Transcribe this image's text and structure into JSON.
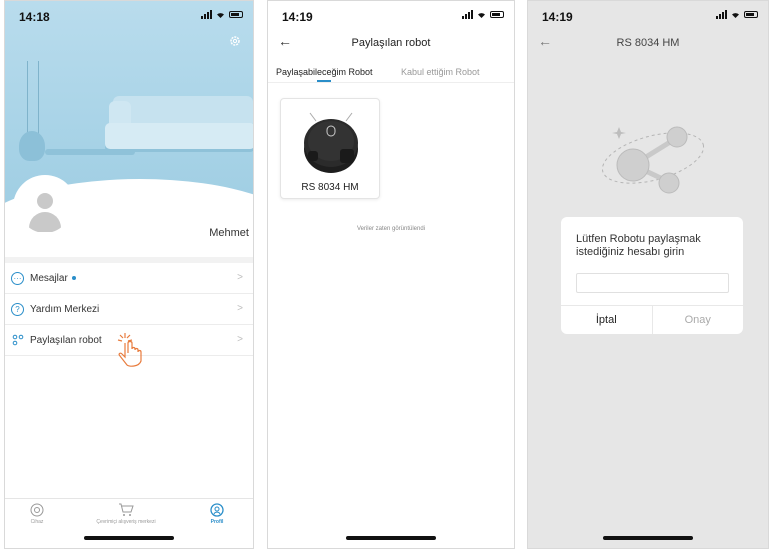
{
  "screen1": {
    "time": "14:18",
    "username": "Mehmet",
    "menu": [
      {
        "label": "Mesajlar"
      },
      {
        "label": "Yardım Merkezi"
      },
      {
        "label": "Paylaşılan robot"
      }
    ],
    "tabbar": [
      {
        "label": "Cihaz"
      },
      {
        "label": "Çevrimiçi alışveriş merkezi"
      },
      {
        "label": "Profil"
      }
    ]
  },
  "screen2": {
    "time": "14:19",
    "title": "Paylaşılan robot",
    "tabs": [
      "Paylaşabileceğim Robot",
      "Kabul ettiğim Robot"
    ],
    "robot_name": "RS 8034 HM",
    "empty_note": "Veriler zaten görüntülendi"
  },
  "screen3": {
    "time": "14:19",
    "title": "RS 8034 HM",
    "dialog": {
      "message": "Lütfen Robotu paylaşmak istediğiniz hesabı girin",
      "input_value": "",
      "cancel_label": "İptal",
      "confirm_label": "Onay"
    }
  },
  "colors": {
    "accent": "#2a8ec9",
    "hero": "#a6d2e6",
    "overlay": "#e6e6e6"
  }
}
